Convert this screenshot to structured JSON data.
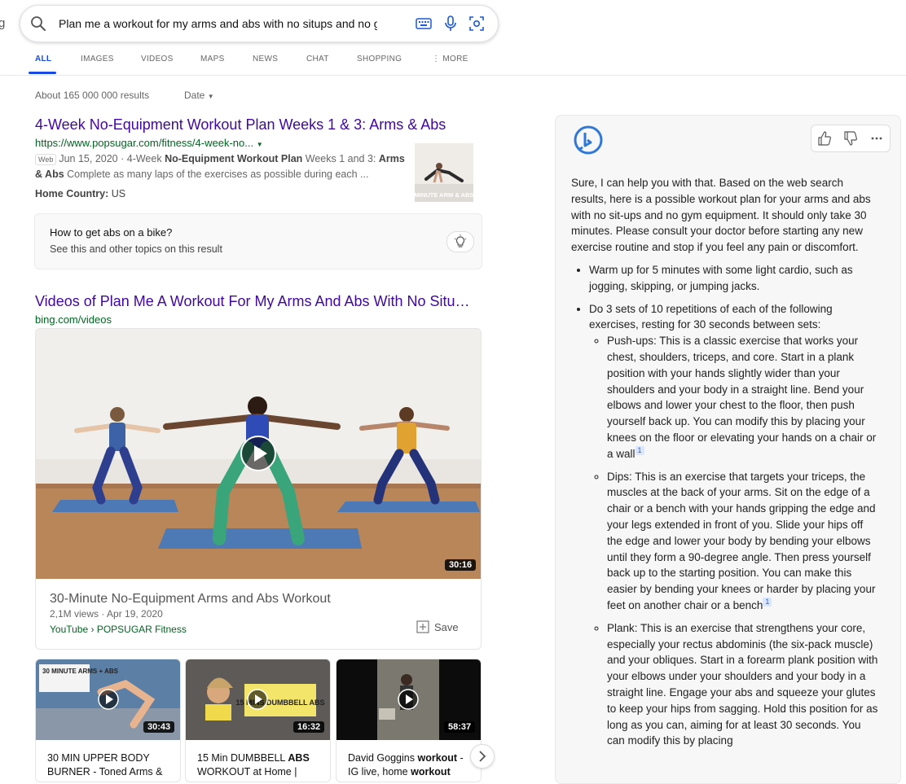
{
  "search": {
    "query": "Plan me a workout for my arms and abs with no situps and no gym equipment"
  },
  "cutoff_glyph": "g",
  "tabs": [
    {
      "label": "ALL",
      "active": true
    },
    {
      "label": "IMAGES"
    },
    {
      "label": "VIDEOS"
    },
    {
      "label": "MAPS"
    },
    {
      "label": "NEWS"
    },
    {
      "label": "CHAT"
    },
    {
      "label": "SHOPPING"
    },
    {
      "label": "MORE"
    }
  ],
  "results_count": "About 165 000 000 results",
  "date_filter": "Date",
  "result1": {
    "title": "4-Week No-Equipment Workout Plan Weeks 1 & 3: Arms & Abs",
    "url": "https://www.popsugar.com/fitness/4-week-no...",
    "badge": "Web",
    "date": "Jun 15, 2020",
    "snippet_plain_1": "4-Week ",
    "snippet_bold_1": "No-Equipment Workout Plan",
    "snippet_plain_2": " Weeks 1 and 3: ",
    "snippet_bold_2": "Arms",
    "snippet_bold_3": "& Abs",
    "snippet_plain_3": " Complete as many laps of the exercises as possible during each ...",
    "country_label": "Home Country:",
    "country_value": "US",
    "thumb_caption": "MINUTE ARM & ABS"
  },
  "related": {
    "question": "How to get abs on a bike?",
    "sub": "See this and other topics on this result"
  },
  "videos": {
    "title": "Videos of Plan Me A Workout For My Arms And Abs With No Situ…",
    "source": "bing.com/videos",
    "main": {
      "duration": "30:16",
      "title": "30-Minute No-Equipment Arms and Abs Workout",
      "meta": "2,1M views · Apr 19, 2020",
      "channel": "YouTube › POPSUGAR Fitness",
      "save_label": "Save"
    },
    "thumbs": [
      {
        "duration": "30:43",
        "badge": "30 MINUTE ARMS + ABS",
        "cap_1": "30 MIN UPPER BODY",
        "cap_2": "BURNER - Toned Arms &"
      },
      {
        "duration": "16:32",
        "badge": "15 MINS DUMBBELL ABS",
        "cap_1": "15 Min DUMBBELL ",
        "cap_bold": "ABS",
        "cap_2": "WORKOUT at Home |"
      },
      {
        "duration": "58:37",
        "cap_1": "David Goggins ",
        "cap_bold": "workout",
        "cap_2": " - IG live, home workout"
      }
    ]
  },
  "copilot": {
    "intro": "Sure, I can help you with that. Based on the web search results, here is a possible workout plan for your arms and abs with no sit-ups and no gym equipment. It should only take 30 minutes. Please consult your doctor before starting any new exercise routine and stop if you feel any pain or discomfort.",
    "bullet1": "Warm up for 5 minutes with some light cardio, such as jogging, skipping, or jumping jacks.",
    "bullet2": "Do 3 sets of 10 repetitions of each of the following exercises, resting for 30 seconds between sets:",
    "sub1": "Push-ups: This is a classic exercise that works your chest, shoulders, triceps, and core. Start in a plank position with your hands slightly wider than your shoulders and your body in a straight line. Bend your elbows and lower your chest to the floor, then push yourself back up. You can modify this by placing your knees on the floor or elevating your hands on a chair or a wall",
    "sub2": "Dips: This is an exercise that targets your triceps, the muscles at the back of your arms. Sit on the edge of a chair or a bench with your hands gripping the edge and your legs extended in front of you. Slide your hips off the edge and lower your body by bending your elbows until they form a 90-degree angle. Then press yourself back up to the starting position. You can make this easier by bending your knees or harder by placing your feet on another chair or a bench",
    "sub3": "Plank: This is an exercise that strengthens your core, especially your rectus abdominis (the six-pack muscle) and your obliques. Start in a forearm plank position with your elbows under your shoulders and your body in a straight line. Engage your abs and squeeze your glutes to keep your hips from sagging. Hold this position for as long as you can, aiming for at least 30 seconds. You can modify this by placing",
    "cite": "1"
  }
}
